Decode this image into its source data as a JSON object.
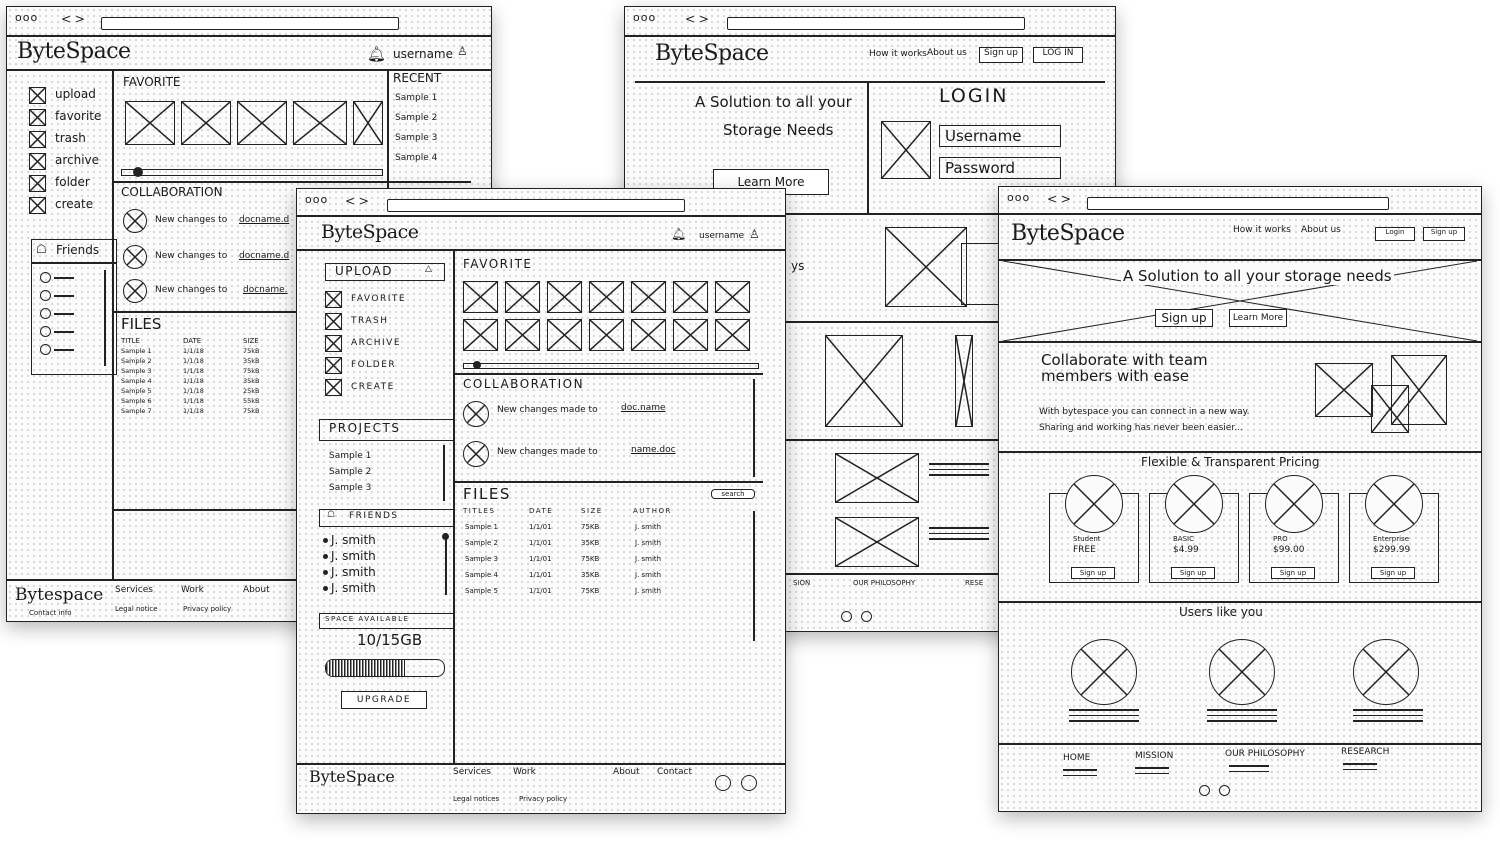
{
  "brand": "ByteSpace",
  "browser": {
    "dots": "ooo",
    "nav": "< >"
  },
  "w1": {
    "header": {
      "logo": "ByteSpace",
      "username": "username"
    },
    "sidebar": [
      "upload",
      "favorite",
      "trash",
      "archive",
      "folder",
      "create"
    ],
    "friends": {
      "title": "Friends"
    },
    "favorite": "FAVORITE",
    "recent": {
      "title": "RECENT",
      "items": [
        "Sample 1",
        "Sample 2",
        "Sample 3",
        "Sample 4"
      ]
    },
    "collab": {
      "title": "COLLABORATION",
      "items": [
        {
          "text": "New changes to",
          "link": "docname.d"
        },
        {
          "text": "New changes to",
          "link": "docname.d"
        },
        {
          "text": "New changes to",
          "link": "docname."
        }
      ]
    },
    "files": {
      "title": "FILES",
      "headers": [
        "TITLE",
        "DATE",
        "SIZE"
      ],
      "rows": [
        [
          "Sample 1",
          "1/1/18",
          "75kB"
        ],
        [
          "Sample 2",
          "1/1/18",
          "35kB"
        ],
        [
          "Sample 3",
          "1/1/18",
          "75kB"
        ],
        [
          "Sample 4",
          "1/1/18",
          "35kB"
        ],
        [
          "Sample 5",
          "1/1/18",
          "25kB"
        ],
        [
          "Sample 6",
          "1/1/18",
          "55kB"
        ],
        [
          "Sample 7",
          "1/1/18",
          "75kB"
        ]
      ]
    },
    "footer": {
      "logo": "Bytespace",
      "sub": "Contact info",
      "links": [
        "Services",
        "Work",
        "About"
      ],
      "legal": [
        "Legal notice",
        "Privacy policy"
      ]
    }
  },
  "w2": {
    "header": {
      "logo": "ByteSpace",
      "nav": [
        "How it works",
        "About us"
      ],
      "signup": "Sign up",
      "login": "LOG IN"
    },
    "hero": {
      "line1": "A Solution to all your",
      "line2": "Storage Needs",
      "learn": "Learn More"
    },
    "login": {
      "title": "LOGIN",
      "username": "Username",
      "password": "Password"
    },
    "bubble": "ys",
    "footer": [
      "SION",
      "OUR PHILOSOPHY",
      "RESE"
    ]
  },
  "w3": {
    "header": {
      "logo": "ByteSpace",
      "username": "username"
    },
    "upload": "UPLOAD",
    "menu": [
      "FAVORITE",
      "TRASH",
      "ARCHIVE",
      "FOLDER",
      "CREATE"
    ],
    "projects": {
      "title": "PROJECTS",
      "items": [
        "Sample 1",
        "Sample 2",
        "Sample 3"
      ]
    },
    "friends": {
      "title": "FRIENDS",
      "items": [
        "J. smith",
        "J. smith",
        "J. smith",
        "J. smith"
      ]
    },
    "space": {
      "title": "SPACE AVAILABLE",
      "value": "10/15GB",
      "fill": 0.667,
      "upgrade": "UPGRADE"
    },
    "favorite": "FAVORITE",
    "collab": {
      "title": "COLLABORATION",
      "items": [
        {
          "text": "New changes made to",
          "link": "doc.name"
        },
        {
          "text": "New changes made to",
          "link": "name.doc"
        }
      ]
    },
    "files": {
      "title": "FILES",
      "search": "search",
      "headers": [
        "TITLES",
        "DATE",
        "SIZE",
        "AUTHOR"
      ],
      "rows": [
        [
          "Sample 1",
          "1/1/01",
          "75KB",
          "J. smith"
        ],
        [
          "Sample 2",
          "1/1/01",
          "35KB",
          "J. smith"
        ],
        [
          "Sample 3",
          "1/1/01",
          "75KB",
          "J. smith"
        ],
        [
          "Sample 4",
          "1/1/01",
          "35KB",
          "J. smith"
        ],
        [
          "Sample 5",
          "1/1/01",
          "75KB",
          "J. smith"
        ]
      ]
    },
    "footer": {
      "logo": "ByteSpace",
      "links": [
        "Services",
        "Work",
        "About",
        "Contact"
      ],
      "legal": [
        "Legal notices",
        "Privacy policy"
      ]
    }
  },
  "w4": {
    "header": {
      "logo": "ByteSpace",
      "nav": [
        "How it works",
        "About us"
      ],
      "login": "Login",
      "signup": "Sign up"
    },
    "hero": {
      "title": "A Solution to all your storage needs",
      "signup": "Sign up",
      "learn": "Learn More"
    },
    "collab": {
      "line1": "Collaborate with team",
      "line2": "members with ease",
      "body1": "With bytespace you can connect in a new way.",
      "body2": "Sharing and working has never been easier..."
    },
    "pricing": {
      "title": "Flexible & Transparent Pricing",
      "plans": [
        {
          "name": "Student",
          "price": "FREE",
          "cta": "Sign up"
        },
        {
          "name": "BASIC",
          "price": "$4.99",
          "cta": "Sign up"
        },
        {
          "name": "PRO",
          "price": "$99.00",
          "cta": "Sign up"
        },
        {
          "name": "Enterprise",
          "price": "$299.99",
          "cta": "Sign up"
        }
      ]
    },
    "users": "Users like you",
    "footer": [
      "HOME",
      "MISSION",
      "OUR PHILOSOPHY",
      "RESEARCH"
    ]
  }
}
